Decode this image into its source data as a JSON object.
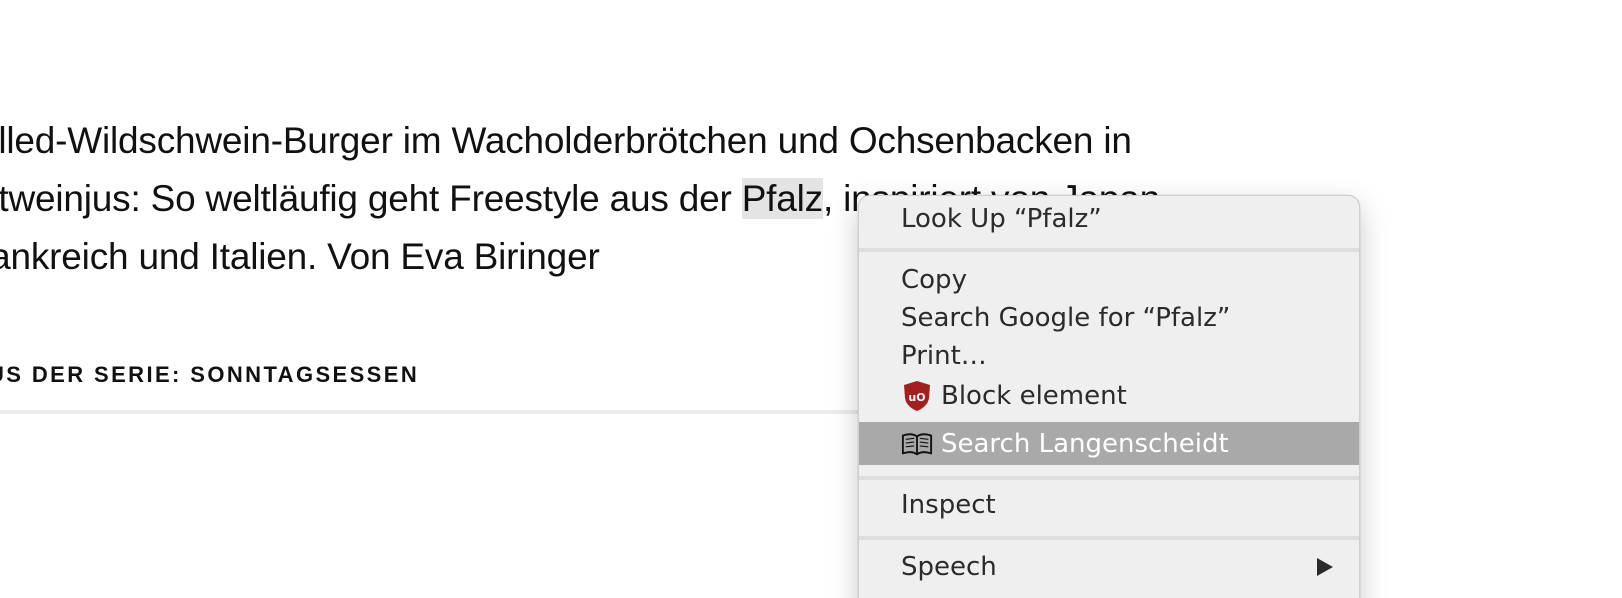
{
  "article": {
    "line1": "ulled-Wildschwein-Burger im Wacholderbrötchen und Ochsenbacken in",
    "line2_before": "otweinjus: So weltläufig geht Freestyle aus der ",
    "selected_word": "Pfalz",
    "line2_after": ", inspiriert von Japan,",
    "line3": "rankreich und Italien. Von Eva Biringer",
    "series_label": "US DER SERIE: SONNTAGSESSEN"
  },
  "context_menu": {
    "look_up": "Look Up “Pfalz”",
    "copy": "Copy",
    "search_google": "Search Google for “Pfalz”",
    "print": "Print…",
    "block_element": {
      "label": "Block element",
      "icon": "ublock-shield-icon"
    },
    "search_langenscheidt": {
      "label": "Search Langenscheidt",
      "icon": "open-book-icon",
      "highlighted": true
    },
    "inspect": "Inspect",
    "speech": {
      "label": "Speech",
      "icon": "submenu-arrow-icon"
    },
    "colors": {
      "highlight": "#a9a9a9",
      "ublock_red": "#a31f1f",
      "menu_bg": "#efefef",
      "selection": "#e4e4e4"
    }
  }
}
